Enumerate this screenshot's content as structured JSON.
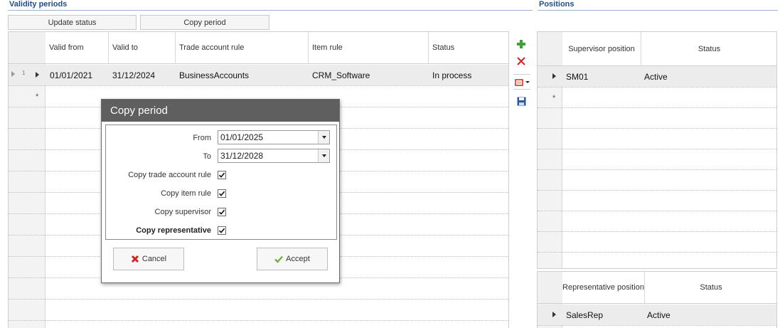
{
  "validity": {
    "title": "Validity periods",
    "toolbar": {
      "update_label": "Update status",
      "copy_label": "Copy period"
    },
    "columns": [
      "Valid from",
      "Valid to",
      "Trade account rule",
      "Item rule",
      "Status"
    ],
    "row_number": "1",
    "row": {
      "valid_from": "01/01/2021",
      "valid_to": "31/12/2024",
      "trade_rule": "BusinessAccounts",
      "item_rule": "CRM_Software",
      "status": "In process"
    },
    "new_row_marker": "*"
  },
  "side_icons": [
    "add-icon",
    "delete-icon",
    "export-icon",
    "save-icon"
  ],
  "positions": {
    "title": "Positions",
    "supervisor": {
      "col_position": "Supervisor position",
      "col_status": "Status",
      "row": {
        "position": "SM01",
        "status": "Active"
      },
      "new_row_marker": "*"
    },
    "representative": {
      "col_position": "Representative position",
      "col_status": "Status",
      "row": {
        "position": "SalesRep",
        "status": "Active"
      }
    }
  },
  "dialog": {
    "title": "Copy period",
    "from_label": "From",
    "from_value": "01/01/2025",
    "to_label": "To",
    "to_value": "31/12/2028",
    "checks": [
      {
        "label": "Copy trade account rule",
        "checked": true
      },
      {
        "label": "Copy item rule",
        "checked": true
      },
      {
        "label": "Copy supervisor",
        "checked": true
      },
      {
        "label": "Copy representative",
        "checked": true
      }
    ],
    "cancel_label": "Cancel",
    "accept_label": "Accept"
  },
  "colors": {
    "section_title": "#1f4e8c",
    "dialog_header": "#5f5f5f",
    "cancel_icon": "#d32020",
    "accept_icon": "#6ab23a"
  }
}
